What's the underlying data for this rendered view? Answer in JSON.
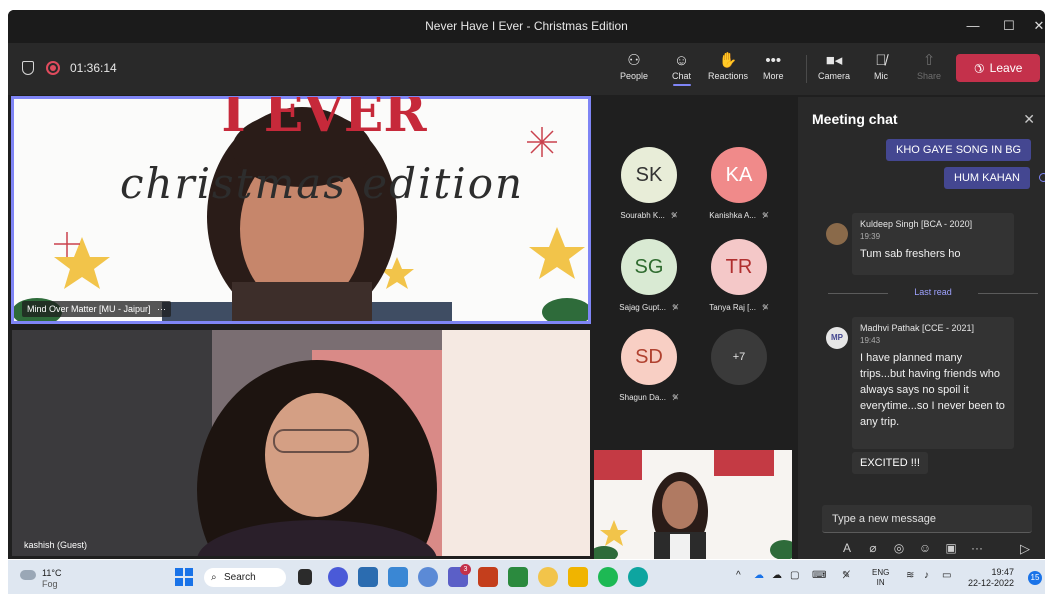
{
  "window": {
    "title": "Never Have I Ever - Christmas Edition",
    "controls": {
      "minimize": "—",
      "maximize": "☐",
      "close": "✕"
    }
  },
  "toolbar": {
    "timer": "01:36:14",
    "buttons": [
      {
        "label": "People",
        "icon": "people-icon"
      },
      {
        "label": "Chat",
        "icon": "chat-icon"
      },
      {
        "label": "Reactions",
        "icon": "reactions-icon"
      },
      {
        "label": "More",
        "icon": "more-icon"
      },
      {
        "label": "Camera",
        "icon": "camera-icon"
      },
      {
        "label": "Mic",
        "icon": "mic-off-icon"
      },
      {
        "label": "Share",
        "icon": "share-icon"
      }
    ],
    "leave_label": "Leave",
    "accent_color": "#7f85f5",
    "leave_color": "#c4314b"
  },
  "stage": {
    "slide_text_top": "I EVER",
    "slide_text_script": "christmas edition",
    "tile1_name": "Mind Over Matter [MU - Jaipur]",
    "tile1_more": "···",
    "tile2_name": "kashish (Guest)"
  },
  "participants": [
    {
      "initials": "SK",
      "name": "Sourabh K...",
      "color": "#e8edd8"
    },
    {
      "initials": "KA",
      "name": "Kanishka A...",
      "color": "#f08a8a"
    },
    {
      "initials": "SG",
      "name": "Sajag Gupt...",
      "color": "#d9ead3"
    },
    {
      "initials": "TR",
      "name": "Tanya Raj [...",
      "color": "#f4c8c8"
    },
    {
      "initials": "SD",
      "name": "Shagun Da...",
      "color": "#f8cfc4"
    },
    {
      "initials": "+7",
      "name": "",
      "color": "#3a3a3a"
    }
  ],
  "chat": {
    "title": "Meeting chat",
    "my_messages": [
      "KHO GAYE SONG IN  BG",
      "HUM KAHAN"
    ],
    "messages": [
      {
        "sender": "Kuldeep Singh [BCA - 2020]",
        "time": "19:39",
        "text": "Tum sab freshers ho"
      },
      {
        "sender": "Madhvi Pathak [CCE - 2021]",
        "avatar": "MP",
        "time": "19:43",
        "text": "I have planned many trips...but having friends who always says no spoil it everytime...so I never been to any trip."
      }
    ],
    "extra_message": "EXCITED !!!",
    "last_read": "Last read",
    "compose_placeholder": "Type a new message"
  },
  "taskbar": {
    "temperature": "11°C",
    "weather": "Fog",
    "search_label": "Search",
    "teams_badge": "3",
    "language_top": "ENG",
    "language_bottom": "IN",
    "time": "19:47",
    "date": "22-12-2022",
    "notifications": "15"
  }
}
